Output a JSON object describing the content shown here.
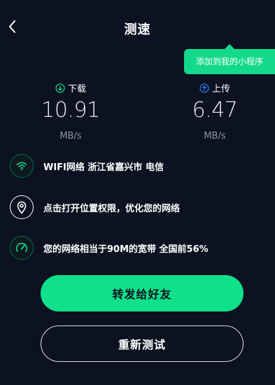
{
  "header": {
    "title": "测速",
    "back_icon": "chevron-left-icon"
  },
  "mini_program_tip": {
    "label": "添加到我的小程序",
    "color": "#14d98a"
  },
  "download": {
    "label": "下载",
    "value": "10.91",
    "unit": "MB/s",
    "icon": "arrow-down-circle-icon",
    "icon_color": "#14d98a"
  },
  "upload": {
    "label": "上传",
    "value": "6.47",
    "unit": "MB/s",
    "icon": "arrow-up-circle-icon",
    "icon_color": "#2f7cf6"
  },
  "info": {
    "network": {
      "text": "WIFI网络 浙江省嘉兴市 电信",
      "icon": "wifi-icon"
    },
    "location": {
      "text": "点击打开位置权限，优化您的网络",
      "icon": "location-pin-icon"
    },
    "bandwidth": {
      "text": "您的网络相当于90M的宽带 全国前56%",
      "icon": "speedometer-icon"
    }
  },
  "actions": {
    "share_label": "转发给好友",
    "retest_label": "重新测试",
    "accent_color": "#0fe08a"
  }
}
